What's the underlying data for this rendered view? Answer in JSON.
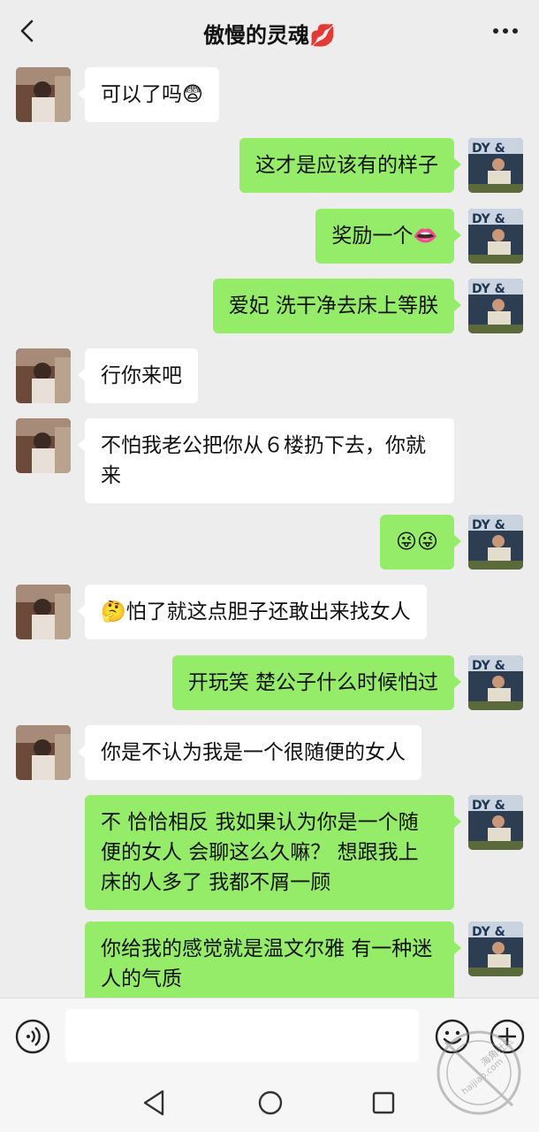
{
  "header": {
    "title": "傲慢的灵魂💋"
  },
  "messages": [
    {
      "side": "in",
      "text": "可以了吗😨"
    },
    {
      "side": "out",
      "text": "这才是应该有的样子"
    },
    {
      "side": "out",
      "text": "奖励一个👄"
    },
    {
      "side": "out",
      "text": "爱妃 洗干净去床上等朕"
    },
    {
      "side": "in",
      "text": "行你来吧"
    },
    {
      "side": "in",
      "text": "不怕我老公把你从６楼扔下去，你就来"
    },
    {
      "side": "out",
      "text": "😜😜"
    },
    {
      "side": "in",
      "text": "🤔怕了就这点胆子还敢出来找女人"
    },
    {
      "side": "out",
      "text": "开玩笑 楚公子什么时候怕过"
    },
    {
      "side": "in",
      "text": "你是不认为我是一个很随便的女人"
    },
    {
      "side": "out",
      "text": "不  恰恰相反 我如果认为你是一个随便的女人 会聊这么久嘛？ 想跟我上床的人多了 我都不屑一顾"
    },
    {
      "side": "out",
      "text": "你给我的感觉就是温文尔雅  有一种迷人的气质"
    }
  ],
  "avatars": {
    "self_text": "DY &"
  },
  "watermark": {
    "text": "海角社区",
    "url": "haijiao.com"
  },
  "icons": {
    "back": "chevron-left-icon",
    "more": "more-dots-icon",
    "voice": "voice-icon",
    "emoji": "emoji-icon",
    "plus": "plus-icon"
  },
  "colors": {
    "background": "#ededed",
    "outgoing_bubble": "#95ec69",
    "incoming_bubble": "#ffffff"
  }
}
